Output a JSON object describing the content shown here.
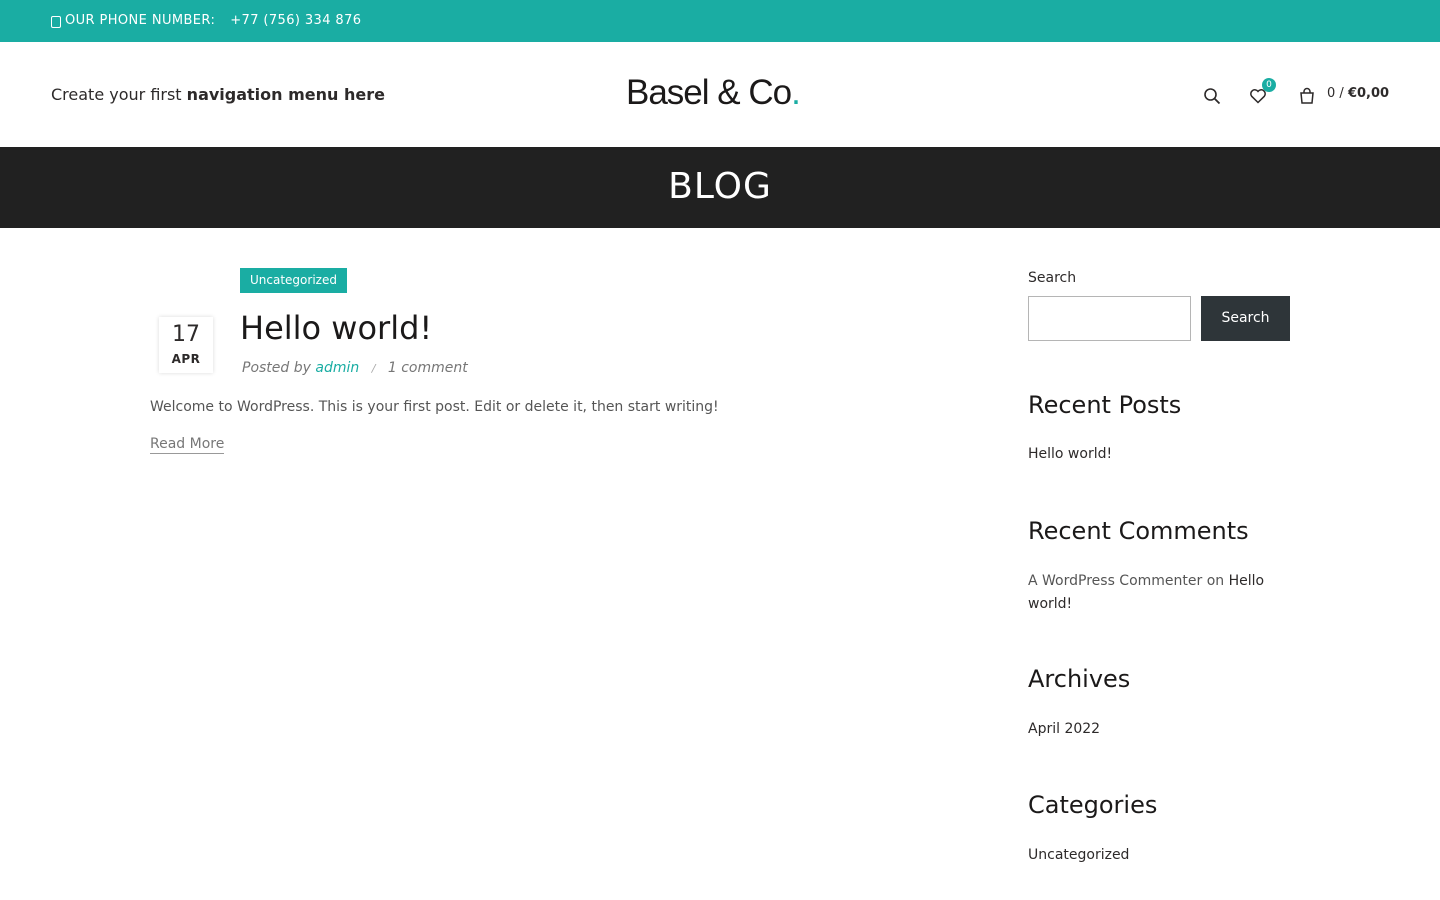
{
  "topbar": {
    "phone_label": "OUR PHONE NUMBER:",
    "phone_number": "+77 (756) 334 876",
    "background": "#1aada3"
  },
  "header": {
    "nav_prefix": "Create your first ",
    "nav_strong": "navigation menu here",
    "logo_text": "Basel & Co",
    "logo_dot": ".",
    "wishlist_count": "0",
    "cart_count": "0",
    "cart_sep": " / ",
    "cart_amount": "€0,00",
    "icons": [
      "search-icon",
      "wishlist-icon",
      "cart-icon"
    ]
  },
  "banner": {
    "title": "BLOG",
    "background": "#212121"
  },
  "post": {
    "category": "Uncategorized",
    "day": "17",
    "month": "APR",
    "title": "Hello world!",
    "posted_by": "Posted by",
    "author": "admin",
    "separator": "/",
    "comments": "1 comment",
    "excerpt": "Welcome to WordPress. This is your first post. Edit or delete it, then start writing!",
    "read_more": "Read More"
  },
  "sidebar": {
    "search_label": "Search",
    "search_button": "Search",
    "recent_posts_title": "Recent Posts",
    "recent_posts": [
      "Hello world!"
    ],
    "recent_comments_title": "Recent Comments",
    "comment_author": "A WordPress Commenter",
    "comment_on": " on ",
    "comment_post": "Hello world!",
    "archives_title": "Archives",
    "archives": [
      "April 2022"
    ],
    "categories_title": "Categories",
    "categories": [
      "Uncategorized"
    ]
  },
  "colors": {
    "accent": "#1aada3",
    "button_dark": "#2e3539"
  }
}
